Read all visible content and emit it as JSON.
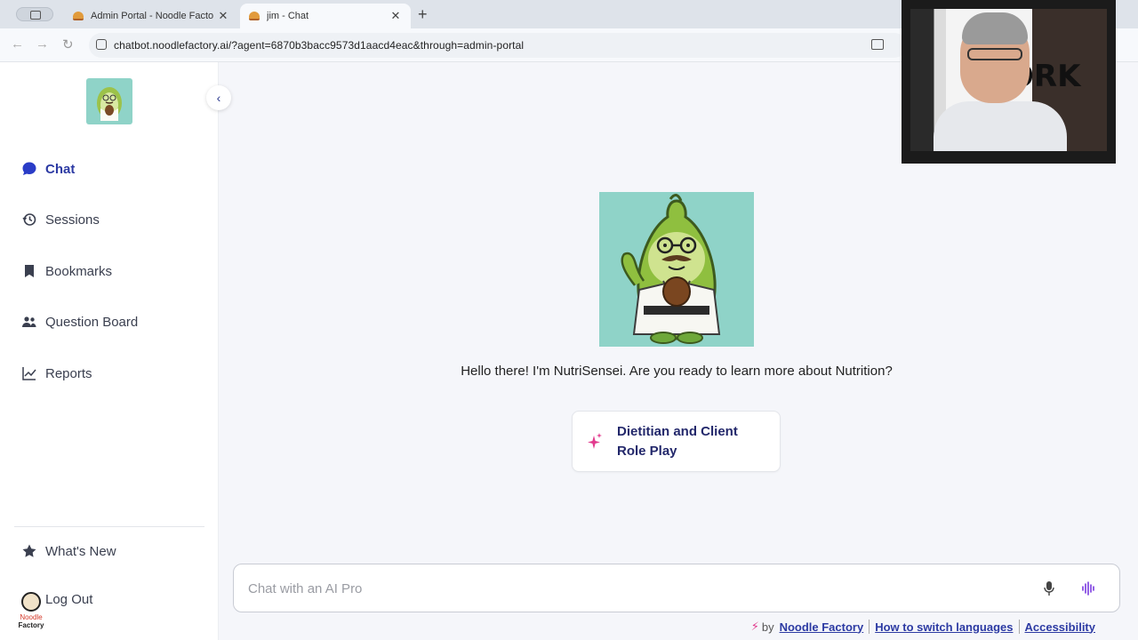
{
  "browser": {
    "tabs": [
      {
        "title": "Admin Portal - Noodle Factory",
        "active": false
      },
      {
        "title": "jim - Chat",
        "active": true
      }
    ],
    "url": "chatbot.noodlefactory.ai/?agent=6870b3bacc9573d1aacd4eac&through=admin-portal"
  },
  "sidebar": {
    "items": [
      {
        "label": "Chat",
        "icon": "chat-bubble-icon",
        "active": true
      },
      {
        "label": "Sessions",
        "icon": "history-icon"
      },
      {
        "label": "Bookmarks",
        "icon": "bookmark-icon"
      },
      {
        "label": "Question Board",
        "icon": "users-icon"
      },
      {
        "label": "Reports",
        "icon": "trend-chart-icon"
      }
    ],
    "bottom_items": [
      {
        "label": "What's New",
        "icon": "star-icon"
      },
      {
        "label": "Log Out",
        "icon": "logout-icon"
      }
    ],
    "brand_text": [
      "Noodle",
      "Factory"
    ]
  },
  "main": {
    "greeting": "Hello there! I'm NutriSensei. Are you ready to learn more about Nutrition?",
    "suggestion": "Dietitian and Client Role Play",
    "chat_placeholder": "Chat with an AI Pro"
  },
  "footer": {
    "by": "by",
    "brand": "Noodle Factory",
    "link_languages": "How to switch languages",
    "link_accessibility": "Accessibility"
  },
  "webcam": {
    "sign_text": "@ORK"
  },
  "colors": {
    "accent": "#2c3aa3",
    "active_chat": "#2a3cc7",
    "avatar_bg": "#8fd3c8",
    "spark": "#e23b8e"
  }
}
